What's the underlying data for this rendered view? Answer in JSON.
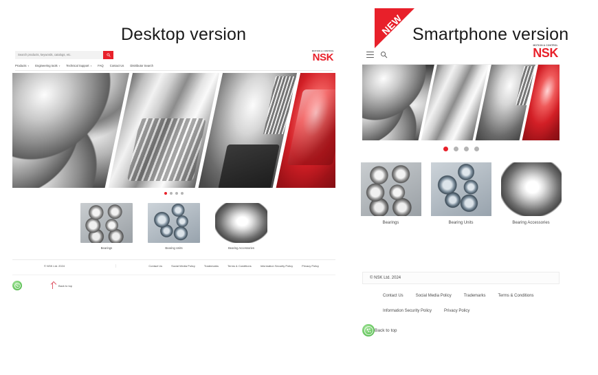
{
  "titles": {
    "desktop": "Desktop version",
    "smartphone": "Smartphone version",
    "new_badge": "NEW"
  },
  "brand": {
    "tagline": "MOTION & CONTROL",
    "name": "NSK",
    "accent_red": "#e8202a",
    "text_gray": "#4a4a4a",
    "cookie_green": "#5cc353"
  },
  "desktop": {
    "search": {
      "placeholder": "Search products, keywords, catalogs, etc.",
      "value": "",
      "button_icon": "search-icon"
    },
    "nav": [
      {
        "label": "Products",
        "has_dropdown": true
      },
      {
        "label": "Engineering tools",
        "has_dropdown": true
      },
      {
        "label": "Technical Support",
        "has_dropdown": true
      },
      {
        "label": "FAQ",
        "has_dropdown": false
      },
      {
        "label": "Contact Us",
        "has_dropdown": false
      },
      {
        "label": "Distributor Search",
        "has_dropdown": false
      }
    ],
    "carousel": {
      "total": 4,
      "active_index": 0
    },
    "products": [
      {
        "label": "Bearings",
        "thumb": "bearings"
      },
      {
        "label": "Bearing Units",
        "thumb": "units"
      },
      {
        "label": "Bearing Accessories",
        "thumb": "accessories"
      }
    ],
    "footer": {
      "copyright": "© NSK Ltd. 2024",
      "links": [
        "Contact Us",
        "Social Media Policy",
        "Trademarks",
        "Terms & Conditions",
        "Information Security Policy",
        "Privacy Policy"
      ],
      "back_to_top": "Back to top",
      "cookie_icon": "cookie-settings-icon"
    }
  },
  "mobile": {
    "header": {
      "menu_icon": "hamburger-menu-icon",
      "search_icon": "search-icon"
    },
    "carousel": {
      "total": 4,
      "active_index": 0
    },
    "products": [
      {
        "label": "Bearings",
        "thumb": "bearings"
      },
      {
        "label": "Bearing Units",
        "thumb": "units"
      },
      {
        "label": "Bearing Accessories",
        "thumb": "accessories"
      }
    ],
    "footer": {
      "copyright": "© NSK Ltd. 2024",
      "links": [
        "Contact Us",
        "Social Media Policy",
        "Trademarks",
        "Terms & Conditions",
        "Information Security Policy",
        "Privacy Policy"
      ],
      "back_to_top": "Back to top",
      "cookie_icon": "cookie-settings-icon"
    }
  }
}
